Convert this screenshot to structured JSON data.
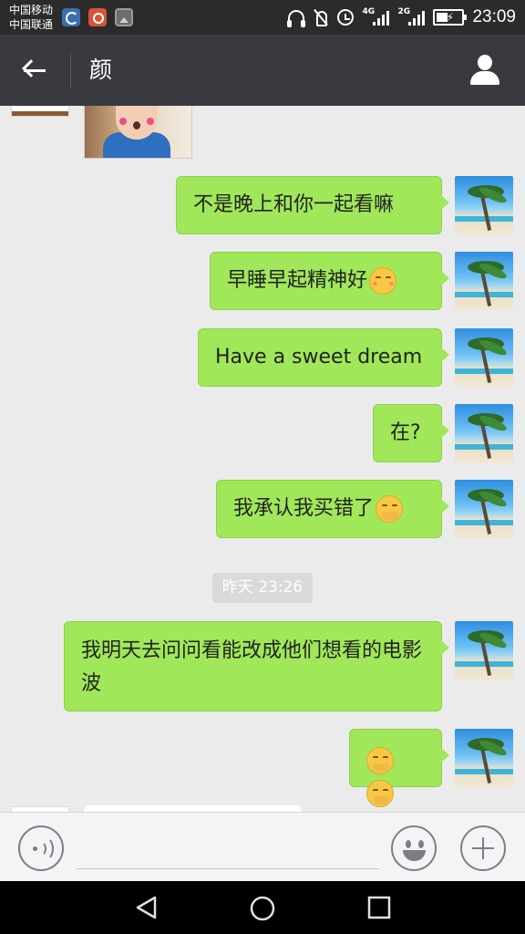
{
  "status_bar": {
    "carrier_1": "中国移动",
    "carrier_2": "中国联通",
    "network_1": "4G",
    "network_2": "2G",
    "time": "23:09",
    "icons": [
      "app-icon",
      "app-icon",
      "gallery-icon",
      "headphones-icon",
      "mute-icon",
      "alarm-icon",
      "signal-icon",
      "signal-icon",
      "battery-charging-icon"
    ]
  },
  "header": {
    "back_icon": "arrow-left-icon",
    "title": "颜",
    "profile_icon": "person-icon"
  },
  "chat": {
    "messages": [
      {
        "text": "不是晚上和你一起看嘛",
        "emoji": ""
      },
      {
        "text": "早睡早起精神好",
        "emoji": "smile-emoji"
      },
      {
        "text": "Have a sweet dream",
        "emoji": ""
      },
      {
        "text": "在?",
        "emoji": ""
      },
      {
        "text": "我承认我买错了",
        "emoji": "hug-emoji"
      },
      {
        "text": "我明天去问问看能改成他们想看的电影波",
        "emoji": ""
      },
      {
        "text": "",
        "emoji": "hug-emoji hug-emoji"
      }
    ],
    "timestamp": "昨天 23:26"
  },
  "input_bar": {
    "value": "",
    "placeholder": ""
  },
  "colors": {
    "outgoing_bubble": "#a0e75a",
    "header_bg": "#393a3f",
    "chat_bg": "#ebebeb"
  }
}
